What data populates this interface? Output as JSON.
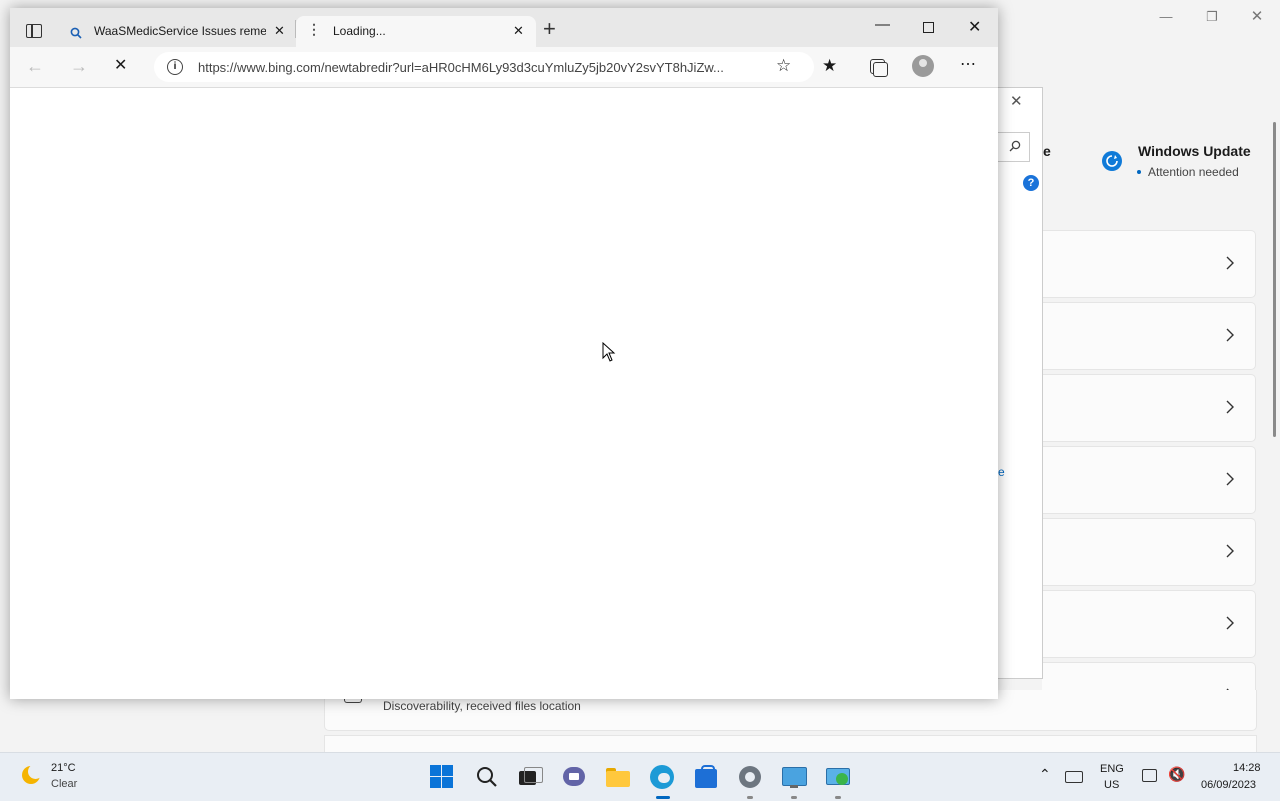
{
  "settings_window": {
    "windows_update_title": "Windows Update",
    "windows_update_status": "Attention needed",
    "bluetooth_subtitle": "Discoverability, received files location",
    "partial_heading_char": "e",
    "partial_link_char": "e"
  },
  "browser": {
    "tabs": [
      {
        "label": "WaaSMedicService Issues remed"
      },
      {
        "label": "Loading..."
      }
    ],
    "url": "https://www.bing.com/newtabredir?url=aHR0cHM6Ly93d3cuYmluZy5jb20vY2svYT8hJiZw...",
    "accent": "#0067c0"
  },
  "taskbar": {
    "weather_temp": "21°C",
    "weather_desc": "Clear",
    "language": "ENG",
    "region": "US",
    "time": "14:28",
    "date": "06/09/2023"
  }
}
